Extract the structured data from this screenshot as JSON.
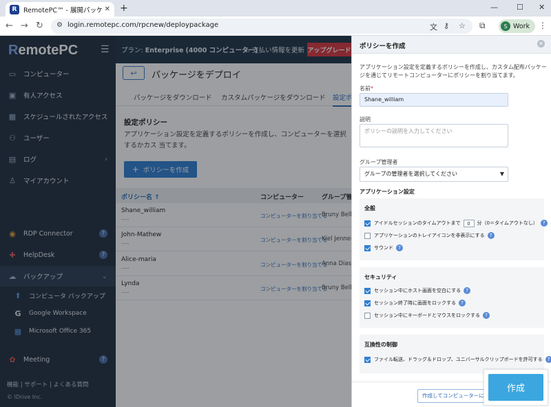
{
  "browser": {
    "tab_title": "RemotePC™ - 展開パッケージ",
    "favicon_letter": "R",
    "url": "login.remotepc.com/rpcnew/deploypackage",
    "profile_initial": "S",
    "profile_label": "Work",
    "new_tab": "+",
    "close": "✕"
  },
  "app": {
    "logo_r": "R",
    "logo_rest": "emotePC",
    "plan_prefix": "プラン: ",
    "plan_name": "Enterprise",
    "plan_detail": "(4000 コンピューター)",
    "billing_label": "支払い情報を更新",
    "upgrade_label": "アップグレード"
  },
  "sidebar": {
    "items": [
      {
        "label": "コンピューター"
      },
      {
        "label": "有人アクセス"
      },
      {
        "label": "スケジュールされたアクセス"
      },
      {
        "label": "ユーザー"
      },
      {
        "label": "ログ"
      },
      {
        "label": "マイアカウント"
      },
      {
        "label": "RDP Connector"
      },
      {
        "label": "HelpDesk"
      },
      {
        "label": "バックアップ"
      },
      {
        "label": "Meeting"
      }
    ],
    "backup_sub": [
      {
        "label": "コンピュータ バックアップ"
      },
      {
        "label": "Google Workspace"
      },
      {
        "label": "Microsoft Office 365"
      }
    ],
    "footer": "機能 | サポート | よくある質問",
    "copyright": "© IDrive Inc."
  },
  "main": {
    "page_title": "パッケージをデプロイ",
    "tabs": [
      {
        "label": "パッケージをダウンロード"
      },
      {
        "label": "カスタムパッケージをダウンロード"
      },
      {
        "label": "設定ポ"
      }
    ],
    "section_title": "設定ポリシー",
    "section_desc": "アプリケーション設定を定義するポリシーを作成し、コンピューターを選択するかカス 当てます。",
    "create_button": "ポリシーを作成",
    "columns": {
      "name": "ポリシー名 ↑",
      "computer": "コンピューター",
      "group": "グループ管理"
    },
    "rows": [
      {
        "name": "Shane_william",
        "dash": "----",
        "assign": "コンピューターを割り当てる",
        "group": "Bruny Bellan"
      },
      {
        "name": "John-Mathew",
        "dash": "----",
        "assign": "コンピューターを割り当てる",
        "group": "Kiel Jenner"
      },
      {
        "name": "Alice-maria",
        "dash": "----",
        "assign": "コンピューターを割り当てる",
        "group": "Anna Diasy"
      },
      {
        "name": "Lynda",
        "dash": "----",
        "assign": "コンピューターを割り当てる",
        "group": "Bruny Bellan"
      }
    ]
  },
  "panel": {
    "title": "ポリシーを作成",
    "desc": "アプリケーション設定を定義するポリシーを作成し、カスタム配布パッケージを通じてリモートコンピューターにポリシーを割り当てます。",
    "name_label": "名前",
    "required_mark": "*",
    "name_value": "Shane_william",
    "desc_label": "説明",
    "desc_placeholder": "ポリシーの説明を入力してください",
    "group_label": "グループ管理者",
    "group_value": "グループの管理者を選択してください",
    "app_settings_title": "アプリケーション設定",
    "general": {
      "title": "全般",
      "idle_prefix": "アイドルセッションのタイムアウトまで",
      "idle_value": "0",
      "idle_suffix": "分（0＝タイムアウトなし）",
      "tray_icon": "アプリケーションのトレイアイコンを非表示にする",
      "sound": "サウンド"
    },
    "security": {
      "title": "セキュリティ",
      "blank_screen": "セッション中にホスト画面を空白にする",
      "lock_screen": "セッション終了時に画面をロックする",
      "lock_input": "セッション中にキーボードとマウスをロックする"
    },
    "compat": {
      "title": "互換性の制御",
      "file_transfer": "ファイル転送、ドラッグ＆ドロップ、ユニバーサルクリップボードを許可する"
    },
    "secondary_button": "作成してコンピューターに割",
    "primary_button": "作成"
  }
}
